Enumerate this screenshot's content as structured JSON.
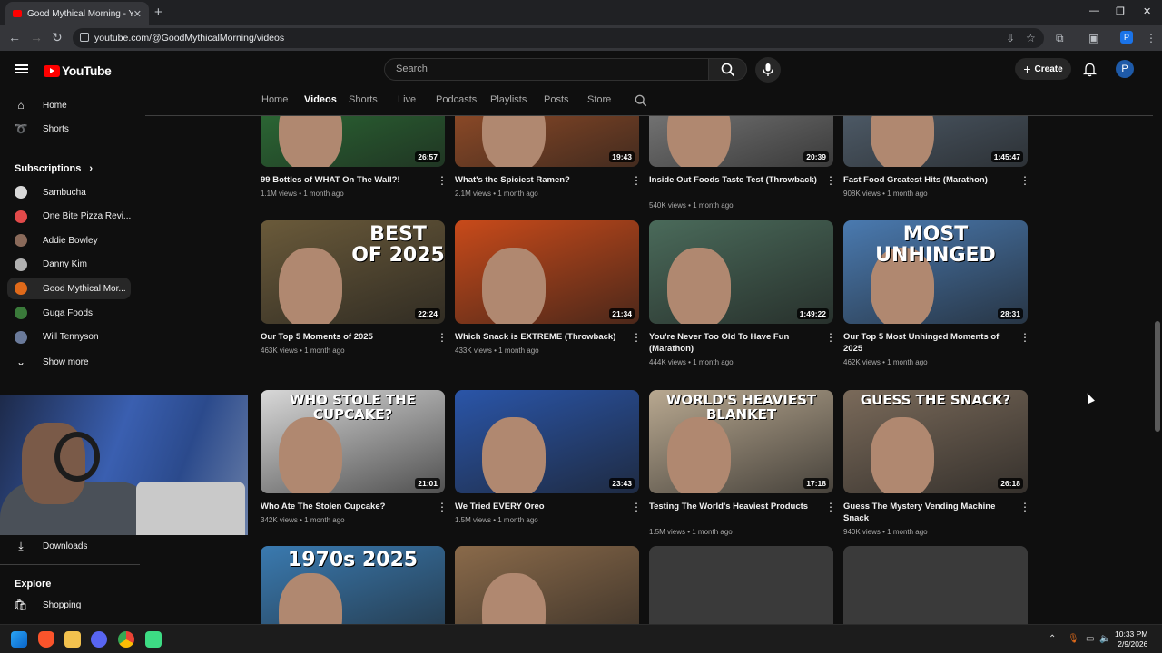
{
  "browser": {
    "tab_title": "Good Mythical Morning - YouTube",
    "url": "youtube.com/@GoodMythicalMorning/videos",
    "profile_initial": "P"
  },
  "youtube": {
    "logo_text": "YouTube",
    "search_placeholder": "Search",
    "create_label": "Create",
    "avatar_initial": "P"
  },
  "sidebar": {
    "home": "Home",
    "shorts": "Shorts",
    "subscriptions_heading": "Subscriptions",
    "subscriptions": [
      {
        "label": "Sambucha",
        "color": "#d9d9d9"
      },
      {
        "label": "One Bite Pizza Revi...",
        "color": "#e24a4a"
      },
      {
        "label": "Addie Bowley",
        "color": "#8a6a5a"
      },
      {
        "label": "Danny Kim",
        "color": "#b0b0b0"
      },
      {
        "label": "Good Mythical Mor...",
        "color": "#e06a1a"
      },
      {
        "label": "Guga Foods",
        "color": "#3a7a3a"
      },
      {
        "label": "Will Tennyson",
        "color": "#6a7a9a"
      }
    ],
    "show_more": "Show more",
    "downloads": "Downloads",
    "explore_heading": "Explore",
    "shopping": "Shopping"
  },
  "channel_tabs": [
    "Home",
    "Videos",
    "Shorts",
    "Live",
    "Podcasts",
    "Playlists",
    "Posts",
    "Store"
  ],
  "active_tab": "Videos",
  "videos": [
    {
      "title": "99 Bottles of WHAT On The Wall?!",
      "meta": "1.1M views • 1 month ago",
      "duration": "26:57",
      "thumb_text": "",
      "bg": "#2f7a3a"
    },
    {
      "title": "What's the Spiciest Ramen?",
      "meta": "2.1M views • 1 month ago",
      "duration": "19:43",
      "thumb_text": "",
      "bg": "#a8552a"
    },
    {
      "title": "Inside Out Foods Taste Test (Throwback)",
      "meta": "540K views • 1 month ago",
      "duration": "20:39",
      "thumb_text": "",
      "bg": "#8a8a8a"
    },
    {
      "title": "Fast Food Greatest Hits (Marathon)",
      "meta": "908K views • 1 month ago",
      "duration": "1:45:47",
      "thumb_text": "",
      "bg": "#5a6a7a"
    },
    {
      "title": "Our Top 5 Moments of 2025",
      "meta": "463K views • 1 month ago",
      "duration": "22:24",
      "thumb_text": "BEST OF 2025",
      "bg": "#6a5a3a"
    },
    {
      "title": "Which Snack is EXTREME (Throwback)",
      "meta": "433K views • 1 month ago",
      "duration": "21:34",
      "thumb_text": "",
      "bg": "#c84a1a"
    },
    {
      "title": "You're Never Too Old To Have Fun (Marathon)",
      "meta": "444K views • 1 month ago",
      "duration": "1:49:22",
      "thumb_text": "",
      "bg": "#4a6a5a"
    },
    {
      "title": "Our Top 5 Most Unhinged Moments of 2025",
      "meta": "462K views • 1 month ago",
      "duration": "28:31",
      "thumb_text": "MOST UNHINGED",
      "bg": "#4a7ab0"
    },
    {
      "title": "Who Ate The Stolen Cupcake?",
      "meta": "342K views • 1 month ago",
      "duration": "21:01",
      "thumb_text": "WHO STOLE THE CUPCAKE?",
      "bg": "#d8d8d8"
    },
    {
      "title": "We Tried EVERY Oreo",
      "meta": "1.5M views • 1 month ago",
      "duration": "23:43",
      "thumb_text": "",
      "bg": "#2a55a8"
    },
    {
      "title": "Testing The World's Heaviest Products",
      "meta": "1.5M views • 1 month ago",
      "duration": "17:18",
      "thumb_text": "WORLD'S HEAVIEST BLANKET",
      "bg": "#b8a890"
    },
    {
      "title": "Guess The Mystery Vending Machine Snack",
      "meta": "940K views • 1 month ago",
      "duration": "26:18",
      "thumb_text": "GUESS THE SNACK?",
      "bg": "#7a6a5a"
    },
    {
      "title": "",
      "meta": "",
      "duration": "",
      "thumb_text": "1970s 2025",
      "bg": "#3a7ab0"
    },
    {
      "title": "",
      "meta": "",
      "duration": "",
      "thumb_text": "",
      "bg": "#8a6a4a"
    },
    {
      "title": "",
      "meta": "",
      "duration": "",
      "thumb_text": "",
      "bg": "#3a3a3a"
    },
    {
      "title": "",
      "meta": "",
      "duration": "",
      "thumb_text": "",
      "bg": "#3a3a3a"
    }
  ],
  "taskbar": {
    "time": "10:33 PM",
    "date": "2/9/2026"
  }
}
